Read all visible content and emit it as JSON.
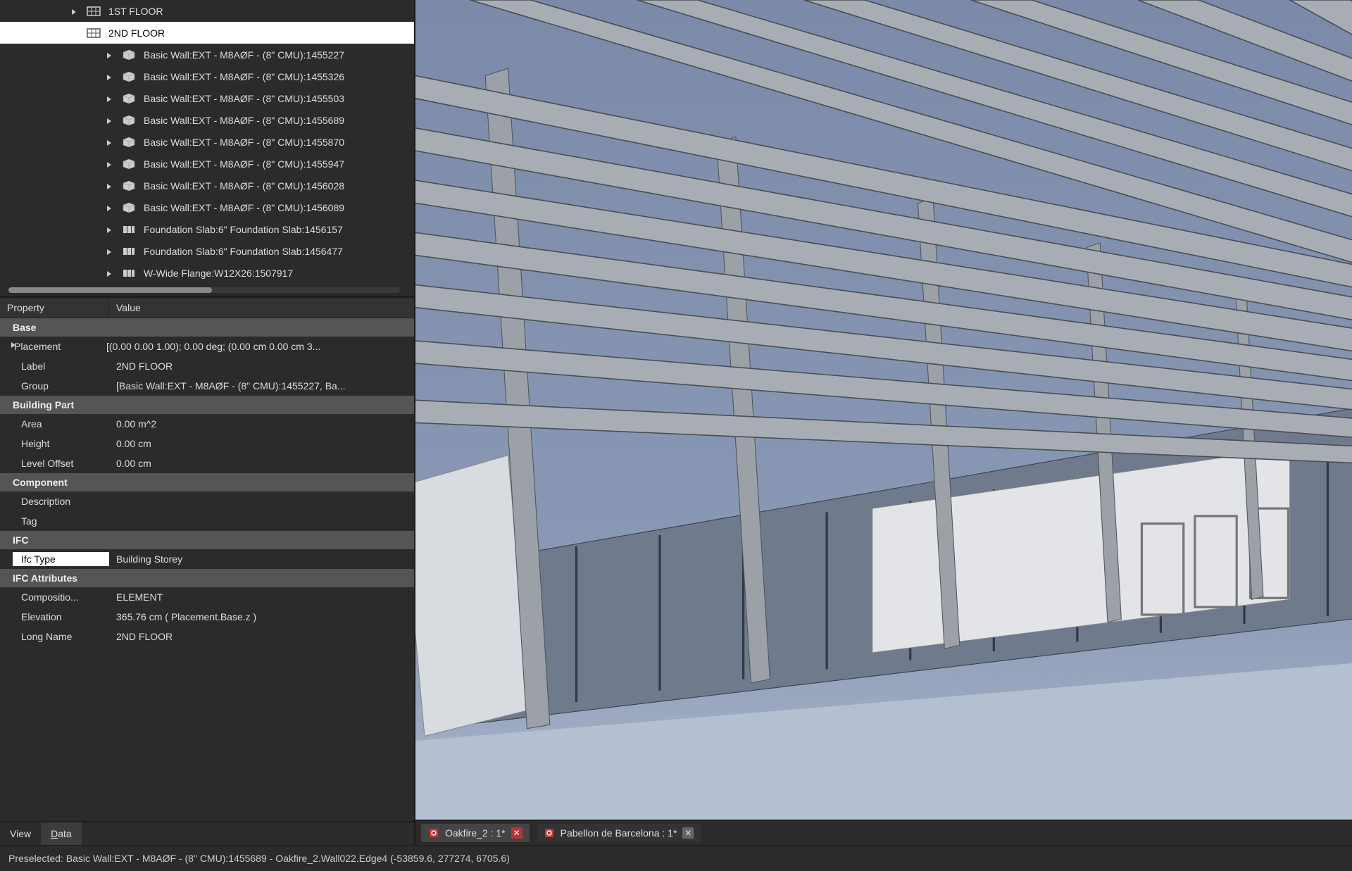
{
  "tree": {
    "floor1": "1ST FLOOR",
    "floor2": "2ND FLOOR",
    "children": [
      "Basic Wall:EXT - M8AØF - (8\" CMU):1455227",
      "Basic Wall:EXT - M8AØF - (8\" CMU):1455326",
      "Basic Wall:EXT - M8AØF - (8\" CMU):1455503",
      "Basic Wall:EXT - M8AØF - (8\" CMU):1455689",
      "Basic Wall:EXT - M8AØF - (8\" CMU):1455870",
      "Basic Wall:EXT - M8AØF - (8\" CMU):1455947",
      "Basic Wall:EXT - M8AØF - (8\" CMU):1456028",
      "Basic Wall:EXT - M8AØF - (8\" CMU):1456089",
      "Foundation Slab:6\" Foundation Slab:1456157",
      "Foundation Slab:6\" Foundation Slab:1456477",
      "W-Wide Flange:W12X26:1507917"
    ]
  },
  "propHeader": {
    "p": "Property",
    "v": "Value"
  },
  "groups": {
    "base": "Base",
    "bp": "Building Part",
    "comp": "Component",
    "ifc": "IFC",
    "ifcattr": "IFC Attributes"
  },
  "props": {
    "placement_k": "Placement",
    "placement_v": "[(0.00 0.00 1.00); 0.00 deg; (0.00 cm  0.00 cm  3...",
    "label_k": "Label",
    "label_v": "2ND FLOOR",
    "group_k": "Group",
    "group_v": "[Basic Wall:EXT - M8AØF - (8\" CMU):1455227, Ba...",
    "area_k": "Area",
    "area_v": "0.00 m^2",
    "height_k": "Height",
    "height_v": "0.00 cm",
    "offset_k": "Level Offset",
    "offset_v": "0.00 cm",
    "desc_k": "Description",
    "desc_v": "",
    "tag_k": "Tag",
    "tag_v": "",
    "ifctype_k": "Ifc Type",
    "ifctype_v": "Building Storey",
    "compo_k": "Compositio...",
    "compo_v": "ELEMENT",
    "elev_k": "Elevation",
    "elev_v": "365.76 cm  ( Placement.Base.z )",
    "long_k": "Long Name",
    "long_v": "2ND FLOOR"
  },
  "bottomTabs": {
    "view": "View",
    "data": "Data"
  },
  "docTabs": {
    "t1": "Oakfire_2 : 1*",
    "t2": "Pabellon de Barcelona : 1*"
  },
  "status": "Preselected: Basic Wall:EXT - M8AØF - (8\" CMU):1455689 - Oakfire_2.Wall022.Edge4 (-53859.6, 277274, 6705.6)"
}
